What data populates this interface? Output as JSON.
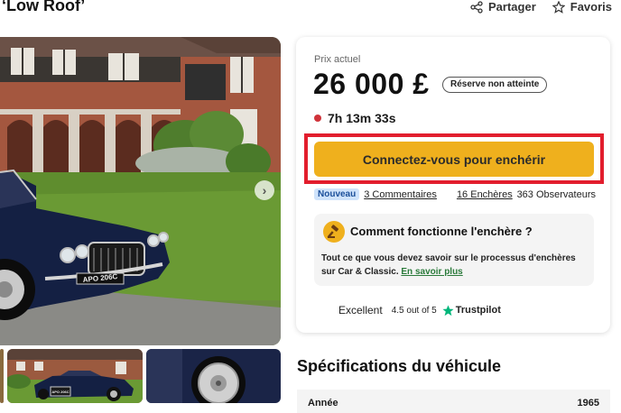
{
  "page": {
    "title": "‘Low Roof’"
  },
  "actions": {
    "share_label": "Partager",
    "favorites_label": "Favoris"
  },
  "gallery": {
    "main_plate": "APO 206C",
    "thumb_plate": "APO 206C"
  },
  "bid": {
    "current_price_label": "Prix actuel",
    "price": "26 000 £",
    "reserve_badge": "Réserve non atteinte",
    "time_left": "7h 13m 33s",
    "button_label": "Connectez-vous pour enchérir"
  },
  "stats": {
    "new_badge": "Nouveau",
    "comments": "3 Commentaires",
    "bids": "16 Enchères",
    "watchers": "363 Observateurs"
  },
  "how_it_works": {
    "title": "Comment fonctionne l'enchère ?",
    "text": "Tout ce que vous devez savoir sur le processus d'enchères sur Car & Classic.",
    "link": "En savoir plus"
  },
  "trustpilot": {
    "rating_word": "Excellent",
    "score": "4.5 out of 5",
    "brand": "Trustpilot"
  },
  "specs": {
    "title": "Spécifications du véhicule",
    "rows": [
      {
        "label": "Année",
        "value": "1965"
      }
    ]
  },
  "colors": {
    "accent": "#efb01d",
    "highlight": "#e21e2d",
    "timer_dot": "#d0333a",
    "link_green": "#2a7a3a"
  }
}
